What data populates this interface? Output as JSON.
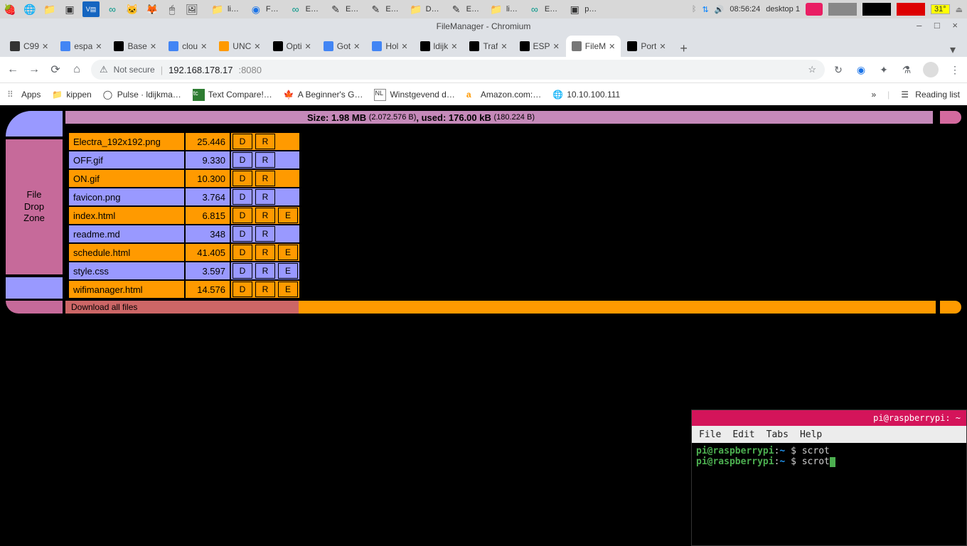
{
  "taskbar": {
    "apps": [
      "li…",
      "F…",
      "E…",
      "E…",
      "E…",
      "D…",
      "E…",
      "li…",
      "E…",
      "p…"
    ],
    "time": "08:56:24",
    "desktop": "desktop 1",
    "temp": "31°"
  },
  "chrome": {
    "window_title": "FileManager - Chromium",
    "tabs": [
      {
        "title": "C99",
        "active": false
      },
      {
        "title": "espa",
        "active": false
      },
      {
        "title": "Base",
        "active": false
      },
      {
        "title": "clou",
        "active": false
      },
      {
        "title": "UNC",
        "active": false
      },
      {
        "title": "Opti",
        "active": false
      },
      {
        "title": "Got",
        "active": false
      },
      {
        "title": "Hol",
        "active": false
      },
      {
        "title": "ldijk",
        "active": false
      },
      {
        "title": "Traf",
        "active": false
      },
      {
        "title": "ESP",
        "active": false
      },
      {
        "title": "FileM",
        "active": true
      },
      {
        "title": "Port",
        "active": false
      }
    ],
    "omnibox": {
      "insecure_label": "Not secure",
      "host": "192.168.178.17",
      "port": ":8080"
    },
    "bookmarks": [
      {
        "label": "Apps"
      },
      {
        "label": "kippen"
      },
      {
        "label": "Pulse · ldijkma…"
      },
      {
        "label": "Text Compare!…"
      },
      {
        "label": "A Beginner's G…"
      },
      {
        "label": "Winstgevend d…"
      },
      {
        "label": "Amazon.com:…"
      },
      {
        "label": "10.10.100.111"
      }
    ],
    "reading_list": "Reading list"
  },
  "filemanager": {
    "size_line_a": "Size: 1.98 MB",
    "size_line_b": "(2.072.576 B)",
    "size_line_c": ", used: 176.00 kB",
    "size_line_d": "(180.224 B)",
    "dropzone": "File\nDrop\nZone",
    "download_all": "Download all files",
    "files": [
      {
        "name": "Electra_192x192.png",
        "size": "25.446",
        "d": "D",
        "r": "R",
        "e": "",
        "cls": "row-orange"
      },
      {
        "name": "OFF.gif",
        "size": "9.330",
        "d": "D",
        "r": "R",
        "e": "",
        "cls": "row-purple"
      },
      {
        "name": "ON.gif",
        "size": "10.300",
        "d": "D",
        "r": "R",
        "e": "",
        "cls": "row-orange"
      },
      {
        "name": "favicon.png",
        "size": "3.764",
        "d": "D",
        "r": "R",
        "e": "",
        "cls": "row-purple"
      },
      {
        "name": "index.html",
        "size": "6.815",
        "d": "D",
        "r": "R",
        "e": "E",
        "cls": "row-orange"
      },
      {
        "name": "readme.md",
        "size": "348",
        "d": "D",
        "r": "R",
        "e": "",
        "cls": "row-purple"
      },
      {
        "name": "schedule.html",
        "size": "41.405",
        "d": "D",
        "r": "R",
        "e": "E",
        "cls": "row-orange"
      },
      {
        "name": "style.css",
        "size": "3.597",
        "d": "D",
        "r": "R",
        "e": "E",
        "cls": "row-purple"
      },
      {
        "name": "wifimanager.html",
        "size": "14.576",
        "d": "D",
        "r": "R",
        "e": "E",
        "cls": "row-orange"
      }
    ]
  },
  "terminal": {
    "title": "pi@raspberrypi: ~",
    "menu": [
      "File",
      "Edit",
      "Tabs",
      "Help"
    ],
    "lines": [
      {
        "user": "pi@raspberrypi",
        "path": "~",
        "sep": "$",
        "cmd": "scrot"
      },
      {
        "user": "pi@raspberrypi",
        "path": "~",
        "sep": "$",
        "cmd": "scrot"
      }
    ]
  }
}
